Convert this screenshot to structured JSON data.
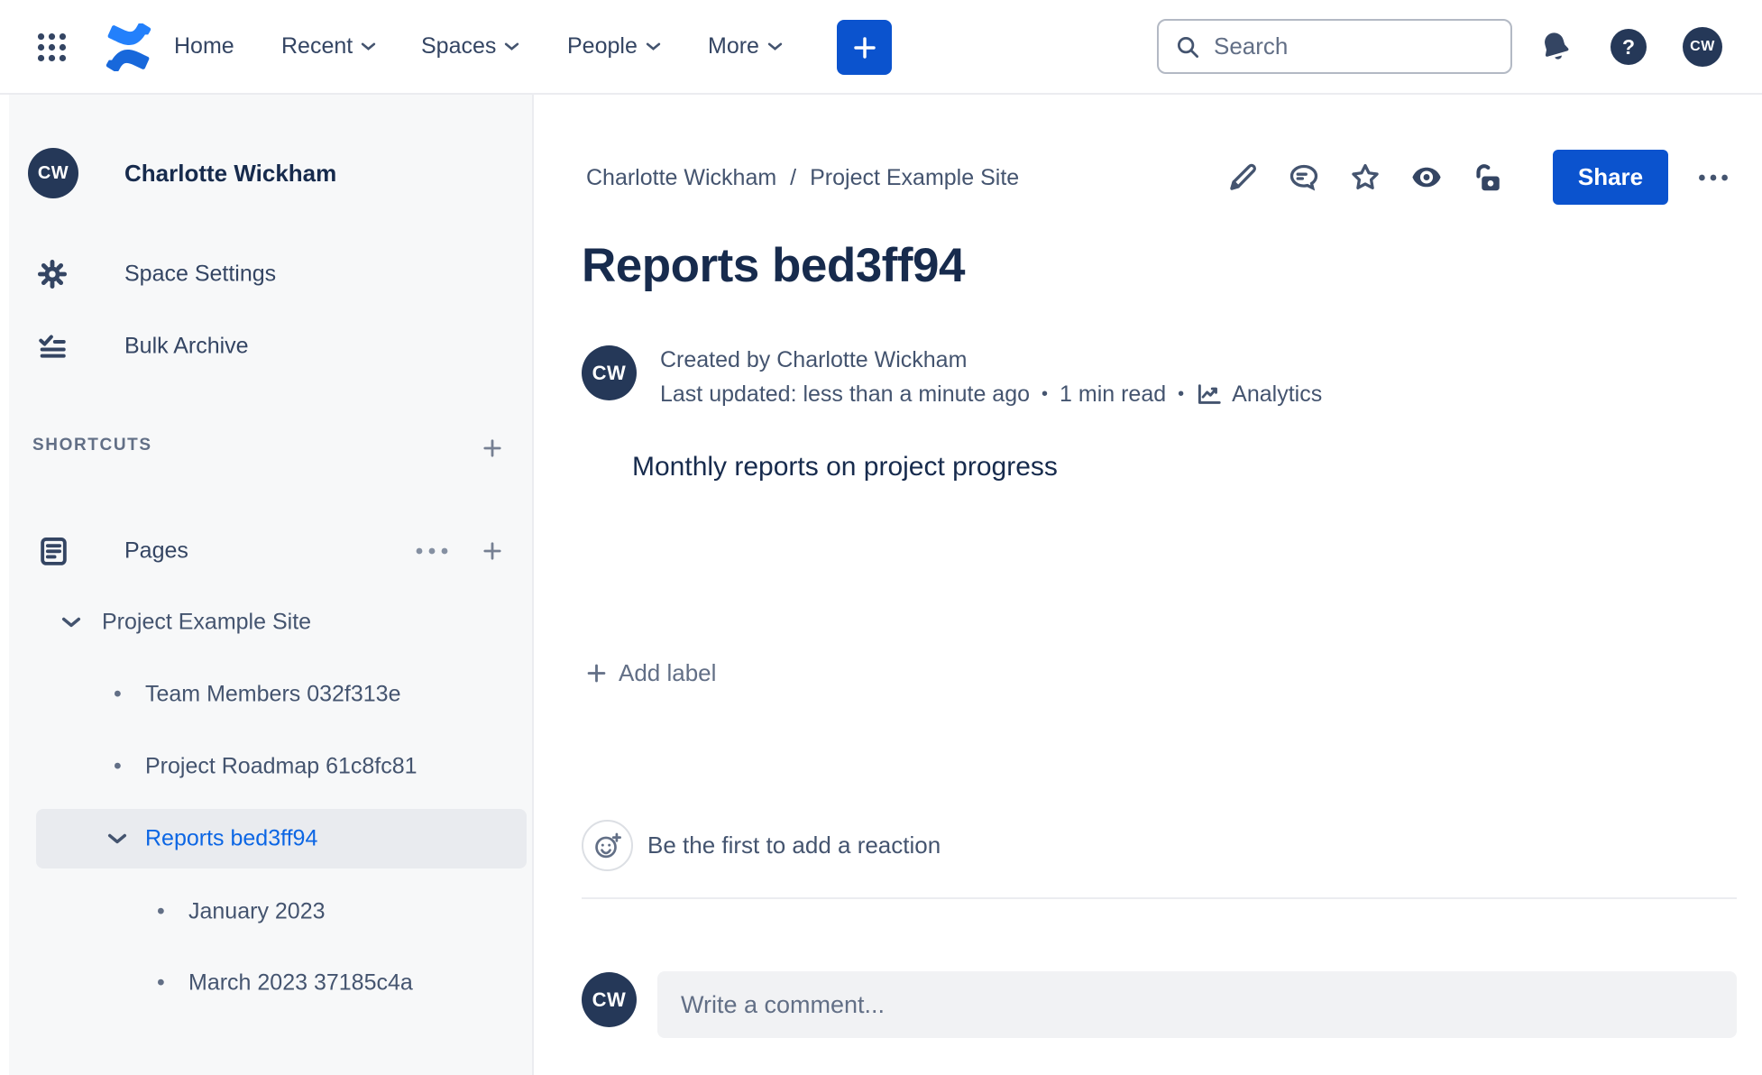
{
  "colors": {
    "accent_blue": "#0B53CE",
    "link_blue": "#0C66E4",
    "navy_text": "#172B4D",
    "slate_text": "#44546F",
    "muted_text": "#626F86",
    "sidebar_bg": "#F7F8F9",
    "selected_bg": "#E9EBEF",
    "comment_input_bg": "#F1F2F4",
    "divider": "#EBECF0",
    "logo_blue": "#1868DB",
    "avatar_navy": "#253858"
  },
  "nav": {
    "menu": [
      "Home",
      "Recent",
      "Spaces",
      "People",
      "More"
    ],
    "search_placeholder": "Search",
    "help_glyph": "?",
    "avatar_initials": "CW"
  },
  "sidebar": {
    "space_name": "Charlotte Wickham",
    "space_initials": "CW",
    "settings_label": "Space Settings",
    "bulk_archive_label": "Bulk Archive",
    "shortcuts_label": "SHORTCUTS",
    "pages_label": "Pages",
    "tree": {
      "root_label": "Project Example Site",
      "items": [
        "Team Members 032f313e",
        "Project Roadmap 61c8fc81"
      ],
      "selected_label": "Reports bed3ff94",
      "sub_items": [
        "January 2023",
        "March 2023 37185c4a"
      ]
    }
  },
  "content": {
    "breadcrumb": {
      "space": "Charlotte Wickham",
      "separator": "/",
      "parent": "Project Example Site"
    },
    "share_label": "Share",
    "title": "Reports bed3ff94",
    "byline": {
      "initials": "CW",
      "created": "Created by Charlotte Wickham",
      "updated": "Last updated: less than a minute ago",
      "dot": "•",
      "read_time": "1 min read",
      "analytics_label": "Analytics"
    },
    "body_text": "Monthly reports on project progress",
    "add_label": "Add label",
    "reaction_prompt": "Be the first to add a reaction",
    "comment_placeholder": "Write a comment..."
  }
}
